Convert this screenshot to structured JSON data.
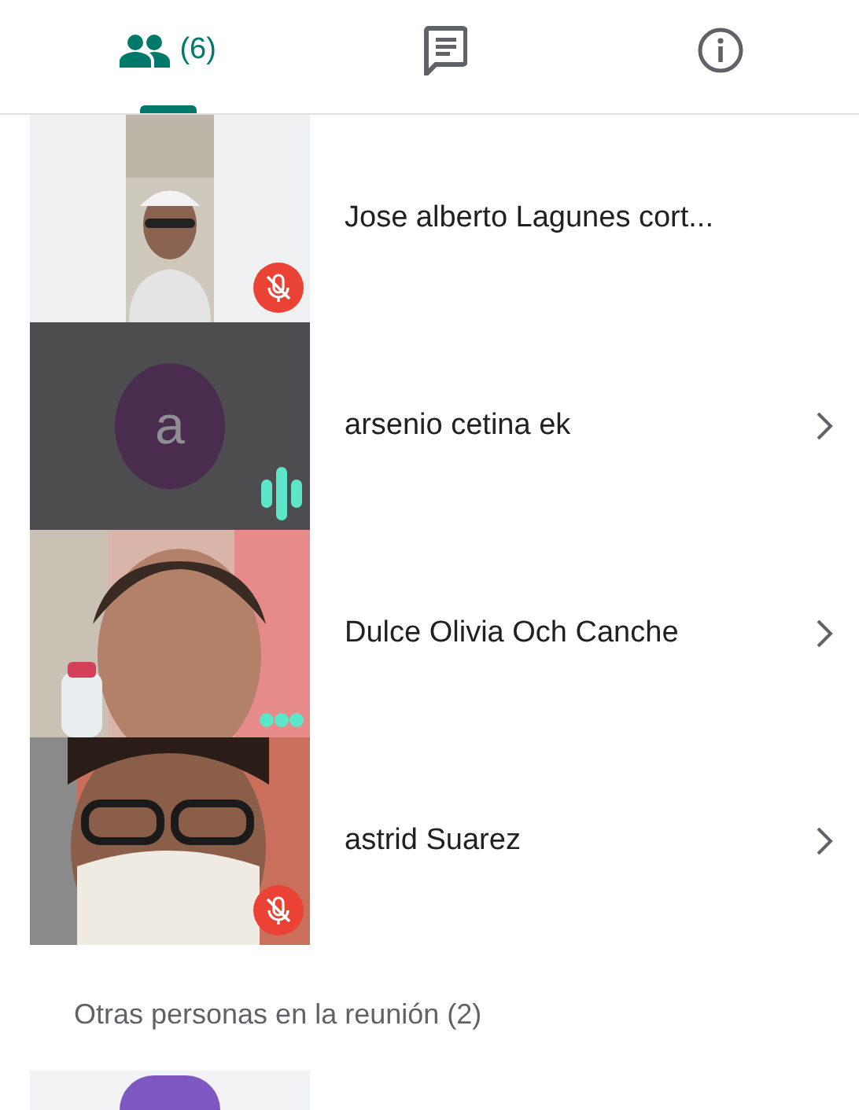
{
  "tabs": [
    {
      "kind": "people",
      "label": "(6)",
      "selected": true
    },
    {
      "kind": "chat",
      "selected": false
    },
    {
      "kind": "info",
      "selected": false
    }
  ],
  "participants": [
    {
      "name": "Jose alberto Lagunes cort...",
      "kind": "video",
      "muted": true,
      "speaking": false,
      "waiting": false,
      "chevron": false
    },
    {
      "name": "arsenio cetina ek",
      "kind": "avatar",
      "letter": "a",
      "color": "#4a2d4e",
      "muted": false,
      "speaking": true,
      "waiting": false,
      "chevron": true
    },
    {
      "name": "Dulce Olivia Och Canche",
      "kind": "video",
      "muted": false,
      "speaking": false,
      "waiting": true,
      "chevron": true
    },
    {
      "name": "astrid Suarez",
      "kind": "video",
      "muted": true,
      "speaking": false,
      "waiting": false,
      "chevron": true
    }
  ],
  "others": {
    "heading": "Otras personas en la reunión (2)",
    "participants": [
      {
        "kind": "avatar",
        "color": "#7e57c2"
      }
    ]
  }
}
